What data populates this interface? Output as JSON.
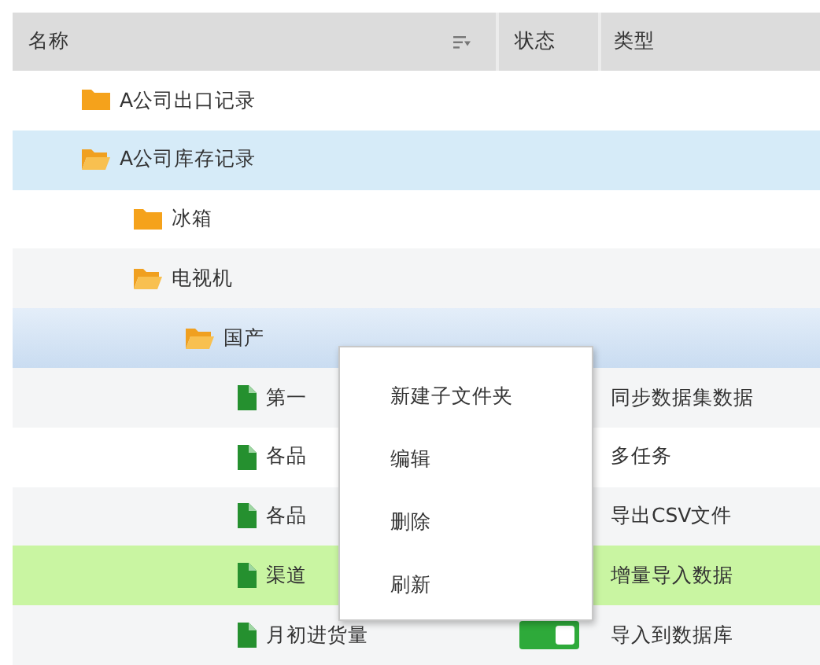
{
  "columns": [
    {
      "label": "名称",
      "sortable": true
    },
    {
      "label": "状态",
      "sortable": false
    },
    {
      "label": "类型",
      "sortable": false
    }
  ],
  "tree": [
    {
      "kind": "folder",
      "name": "A公司出口记录",
      "expanded": false,
      "selected": false,
      "hovered": false
    },
    {
      "kind": "folder",
      "name": "A公司库存记录",
      "expanded": true,
      "selected": true,
      "hovered": false,
      "children": [
        {
          "kind": "folder",
          "name": "冰箱",
          "expanded": false,
          "selected": false,
          "hovered": false
        },
        {
          "kind": "folder",
          "name": "电视机",
          "expanded": true,
          "selected": false,
          "hovered": false,
          "children": [
            {
              "kind": "folder",
              "name": "国产",
              "expanded": true,
              "selected": false,
              "hovered": true,
              "children": [
                {
                  "kind": "file",
                  "name": "第一",
                  "type": "同步数据集数据",
                  "selected": false,
                  "marked": false
                },
                {
                  "kind": "file",
                  "name": "各品",
                  "type": "多任务",
                  "selected": false,
                  "marked": false
                },
                {
                  "kind": "file",
                  "name": "各品",
                  "type": "导出CSV文件",
                  "selected": false,
                  "marked": false
                },
                {
                  "kind": "file",
                  "name": "渠道",
                  "type": "增量导入数据",
                  "selected": false,
                  "marked": true
                },
                {
                  "kind": "file",
                  "name": "月初进货量",
                  "type": "导入到数据库",
                  "selected": false,
                  "marked": false,
                  "status": {
                    "on": true
                  }
                }
              ]
            }
          ]
        }
      ]
    }
  ],
  "context_menu": {
    "items": [
      "新建子文件夹",
      "编辑",
      "删除",
      "刷新"
    ]
  }
}
